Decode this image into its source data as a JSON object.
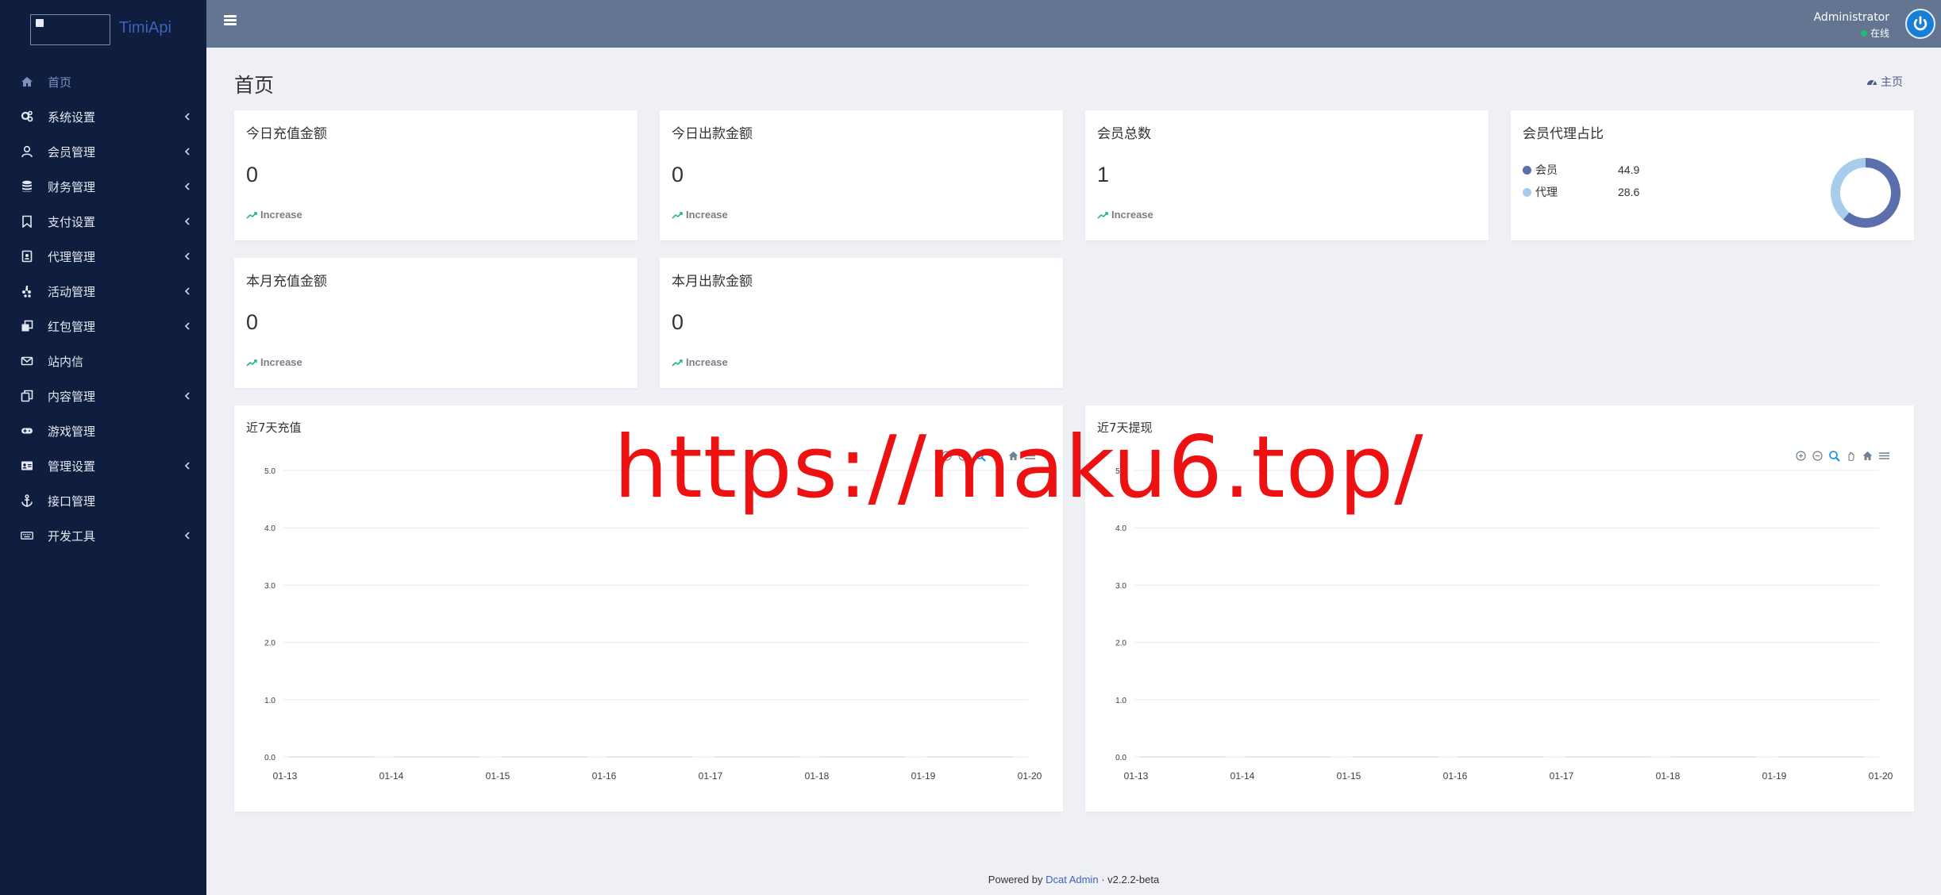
{
  "brand": {
    "name": "TimiApi"
  },
  "sidebar": {
    "items": [
      {
        "label": "首页",
        "icon": "home-icon",
        "chevron": false,
        "active": true
      },
      {
        "label": "系统设置",
        "icon": "gears-icon",
        "chevron": true
      },
      {
        "label": "会员管理",
        "icon": "user-icon",
        "chevron": true
      },
      {
        "label": "财务管理",
        "icon": "database-icon",
        "chevron": true
      },
      {
        "label": "支付设置",
        "icon": "bookmark-icon",
        "chevron": true
      },
      {
        "label": "代理管理",
        "icon": "portrait-icon",
        "chevron": true
      },
      {
        "label": "活动管理",
        "icon": "yelp-icon",
        "chevron": true
      },
      {
        "label": "红包管理",
        "icon": "clone-icon",
        "chevron": true
      },
      {
        "label": "站内信",
        "icon": "envelope-icon",
        "chevron": false
      },
      {
        "label": "内容管理",
        "icon": "copy-icon",
        "chevron": true
      },
      {
        "label": "游戏管理",
        "icon": "gamepad-icon",
        "chevron": false
      },
      {
        "label": "管理设置",
        "icon": "id-card-icon",
        "chevron": true
      },
      {
        "label": "接口管理",
        "icon": "anchor-icon",
        "chevron": false
      },
      {
        "label": "开发工具",
        "icon": "keyboard-icon",
        "chevron": true
      }
    ]
  },
  "header": {
    "user_name": "Administrator",
    "user_status": "在线"
  },
  "page": {
    "title": "首页",
    "breadcrumb": "主页"
  },
  "cards": {
    "today_recharge": {
      "title": "今日充值金额",
      "value": "0",
      "trend": "Increase"
    },
    "today_withdraw": {
      "title": "今日出款金额",
      "value": "0",
      "trend": "Increase"
    },
    "members_total": {
      "title": "会员总数",
      "value": "1",
      "trend": "Increase"
    },
    "month_recharge": {
      "title": "本月充值金额",
      "value": "0",
      "trend": "Increase"
    },
    "month_withdraw": {
      "title": "本月出款金额",
      "value": "0",
      "trend": "Increase"
    },
    "ratio": {
      "title": "会员代理占比",
      "items": [
        {
          "label": "会员",
          "value": "44.9",
          "color": "#5b6fad"
        },
        {
          "label": "代理",
          "value": "28.6",
          "color": "#a8cdec"
        }
      ]
    }
  },
  "chart_data": [
    {
      "type": "line",
      "title": "近7天充值",
      "categories": [
        "01-13",
        "01-14",
        "01-15",
        "01-16",
        "01-17",
        "01-18",
        "01-19",
        "01-20"
      ],
      "values": [
        0,
        0,
        0,
        0,
        0,
        0,
        0,
        0
      ],
      "yticks": [
        "0.0",
        "1.0",
        "2.0",
        "3.0",
        "4.0",
        "5.0"
      ],
      "ylim": [
        0,
        5
      ]
    },
    {
      "type": "line",
      "title": "近7天提现",
      "categories": [
        "01-13",
        "01-14",
        "01-15",
        "01-16",
        "01-17",
        "01-18",
        "01-19",
        "01-20"
      ],
      "values": [
        0,
        0,
        0,
        0,
        0,
        0,
        0,
        0
      ],
      "yticks": [
        "0.0",
        "1.0",
        "2.0",
        "3.0",
        "4.0",
        "5.0"
      ],
      "ylim": [
        0,
        5
      ]
    }
  ],
  "footer": {
    "prefix": "Powered by",
    "link": "Dcat Admin",
    "separator": "·",
    "version": "v2.2.2-beta"
  },
  "watermark": "https://maku6.top/"
}
